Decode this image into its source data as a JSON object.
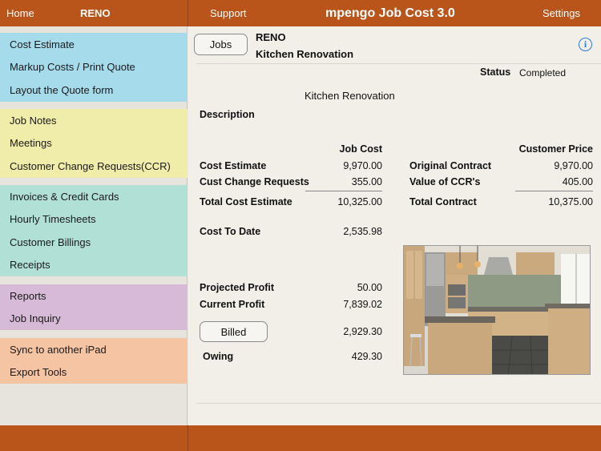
{
  "topbar": {
    "home_label": "Home",
    "job_code": "RENO",
    "support_label": "Support",
    "app_title": "mpengo Job Cost 3.0",
    "settings_label": "Settings"
  },
  "sidebar": {
    "groups": [
      {
        "items": [
          "Cost Estimate",
          "Markup Costs / Print Quote",
          "Layout the Quote form"
        ]
      },
      {
        "items": [
          "Job Notes",
          "Meetings",
          "Customer Change Requests(CCR)"
        ]
      },
      {
        "items": [
          "Invoices & Credit Cards",
          "Hourly Timesheets",
          "Customer Billings",
          "Receipts"
        ]
      },
      {
        "items": [
          "Reports",
          "Job Inquiry"
        ]
      },
      {
        "items": [
          "Sync to another iPad",
          "Export Tools"
        ]
      }
    ]
  },
  "job": {
    "jobs_button": "Jobs",
    "code": "RENO",
    "name": "Kitchen Renovation",
    "status_label": "Status",
    "status_value": "Completed",
    "center_name": "Kitchen Renovation",
    "description_label": "Description"
  },
  "cost": {
    "job_cost_header": "Job Cost",
    "customer_price_header": "Customer Price",
    "cost_estimate_label": "Cost Estimate",
    "cost_estimate_value": "9,970.00",
    "ccr_label": "Cust Change Requests",
    "ccr_value": "355.00",
    "total_cost_label": "Total Cost Estimate",
    "total_cost_value": "10,325.00",
    "original_contract_label": "Original Contract",
    "original_contract_value": "9,970.00",
    "value_ccr_label": "Value of CCR's",
    "value_ccr_value": "405.00",
    "total_contract_label": "Total Contract",
    "total_contract_value": "10,375.00",
    "cost_to_date_label": "Cost To Date",
    "cost_to_date_value": "2,535.98",
    "projected_profit_label": "Projected Profit",
    "projected_profit_value": "50.00",
    "current_profit_label": "Current Profit",
    "current_profit_value": "7,839.02",
    "billed_button": "Billed",
    "billed_value": "2,929.30",
    "owing_label": "Owing",
    "owing_value": "429.30"
  }
}
